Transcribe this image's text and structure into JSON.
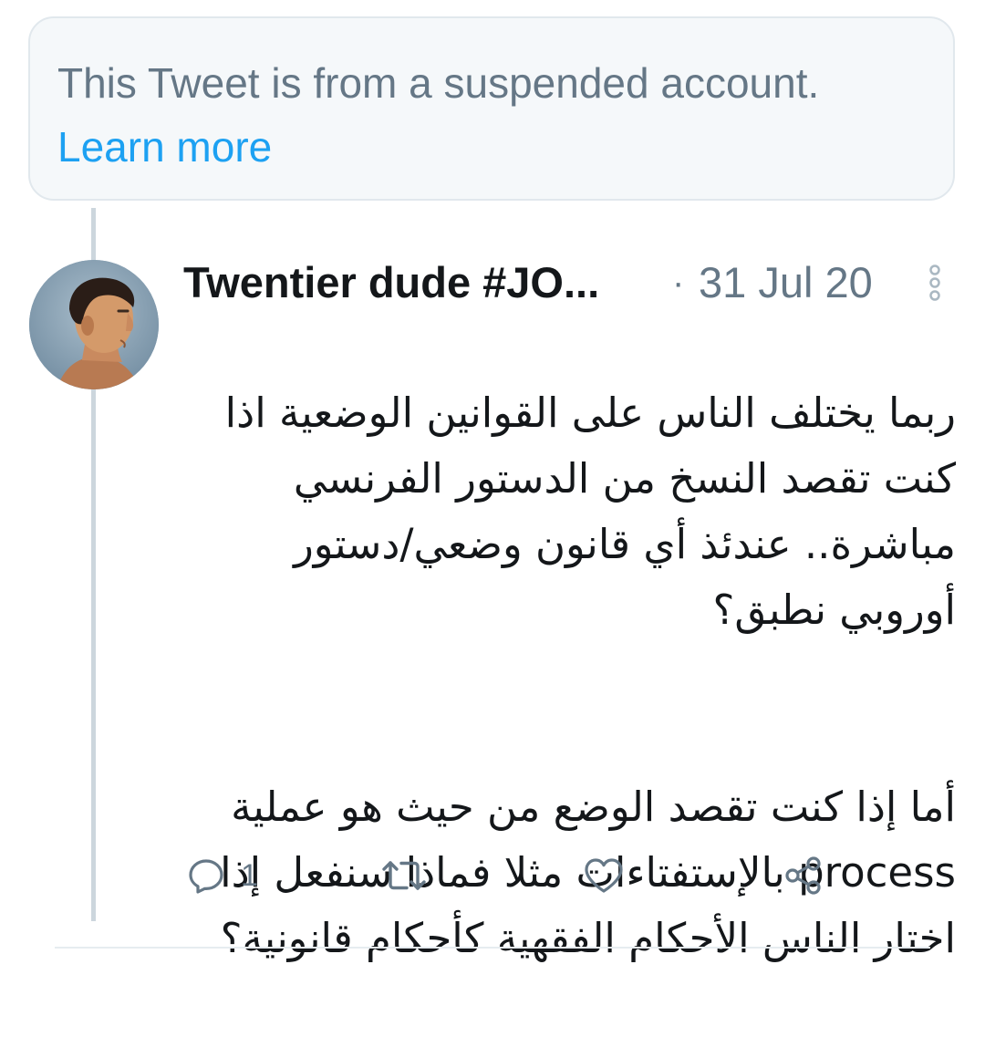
{
  "suspended_notice": {
    "text": "This Tweet is from a suspended account.",
    "link_label": "Learn more",
    "link_color": "#1da1f2"
  },
  "tweet": {
    "author_name": "Twentier dude #JO...",
    "separator": "·",
    "date": "31 Jul 20",
    "body_paragraph_1": "ربما يختلف الناس على القوانين الوضعية اذا\nكنت تقصد النسخ من الدستور الفرنسي\nمباشرة.. عندئذ أي قانون وضعي/دستور\nأوروبي نطبق؟",
    "body_paragraph_2": "أما إذا كنت تقصد الوضع  من حيث هو عملية\nprocess بالإستفتاءات مثلا فماذا سنفعل إذا\nاختار الناس الأحكام الفقهية كأحكام قانونية؟",
    "reply_count": "1"
  },
  "icons": {
    "avatar": "avatar-portrait",
    "menu": "more-vertical-icon",
    "reply": "reply-icon",
    "retweet": "retweet-icon",
    "like": "heart-icon",
    "share": "share-icon"
  },
  "colors": {
    "secondary_text": "#657786",
    "primary_text": "#14171a",
    "thread_line": "#ccd6dd",
    "notice_background": "#f5f8fa"
  }
}
